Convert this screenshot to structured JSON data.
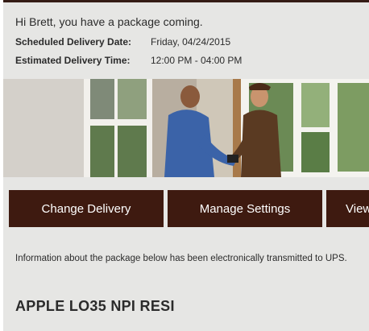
{
  "header": {
    "greeting": "Hi Brett, you have a package coming."
  },
  "delivery": {
    "scheduled_label": "Scheduled Delivery Date:",
    "scheduled_value": "Friday, 04/24/2015",
    "estimated_label": "Estimated Delivery Time:",
    "estimated_value": "12:00 PM - 04:00 PM"
  },
  "hero": {
    "image": "ups-driver-delivering-package-photo"
  },
  "actions": {
    "change_delivery": "Change Delivery",
    "manage_settings": "Manage Settings",
    "view": "View"
  },
  "info": {
    "text": "Information about the package below has been electronically transmitted to UPS."
  },
  "package": {
    "title": "APPLE LO35 NPI RESI"
  },
  "colors": {
    "brand_brown": "#3e1a10",
    "background": "#e6e6e4",
    "text": "#2b2b2b"
  }
}
